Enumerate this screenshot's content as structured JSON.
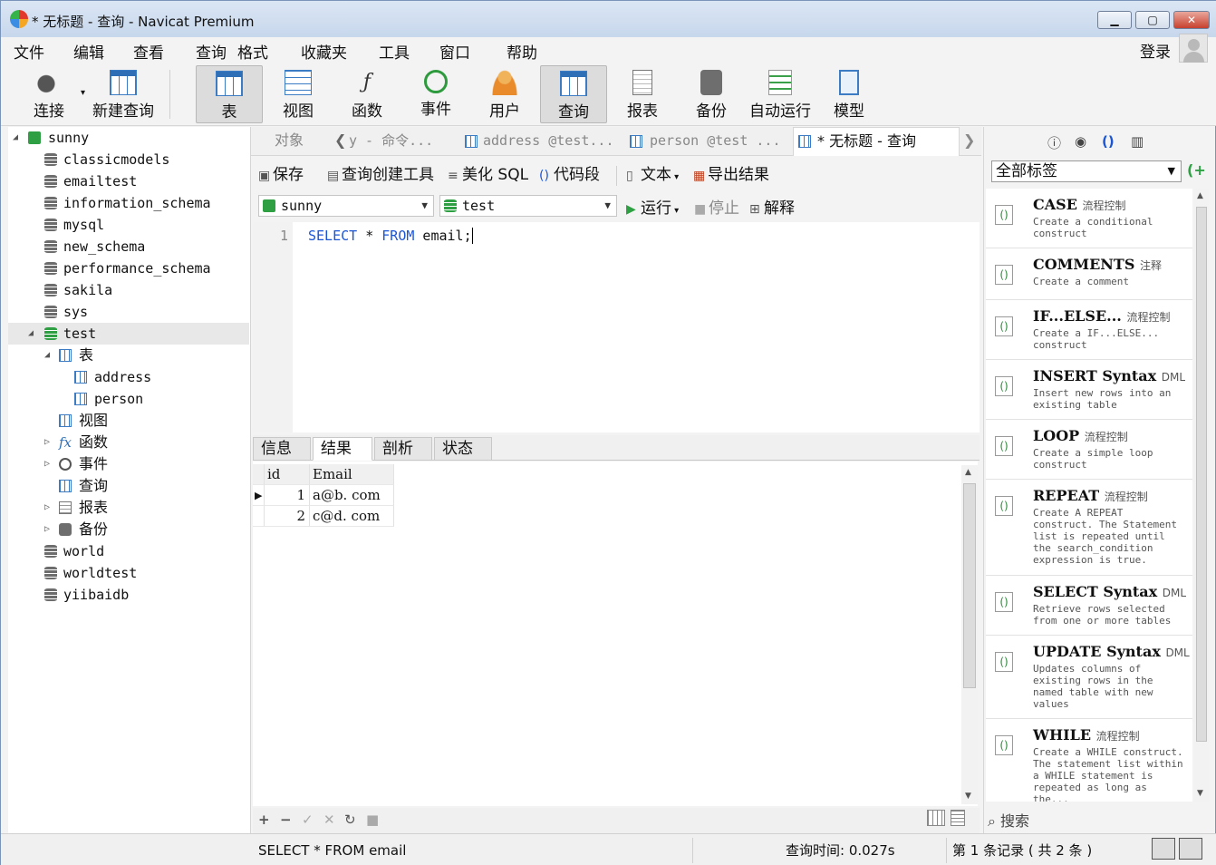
{
  "window": {
    "title": "* 无标题 - 查询 - Navicat Premium",
    "minimize_label": "▁",
    "maximize_label": "▢",
    "close_label": "✕"
  },
  "menu": [
    "文件",
    "编辑",
    "查看",
    "查询",
    "格式",
    "收藏夹",
    "工具",
    "窗口",
    "帮助"
  ],
  "account": {
    "login_label": "登录"
  },
  "toolbar": [
    {
      "label": "连接",
      "icon": "plug-icon"
    },
    {
      "label": "新建查询",
      "icon": "new-query-icon"
    },
    {
      "label": "表",
      "icon": "table-icon"
    },
    {
      "label": "视图",
      "icon": "view-icon"
    },
    {
      "label": "函数",
      "icon": "function-icon"
    },
    {
      "label": "事件",
      "icon": "clock-icon"
    },
    {
      "label": "用户",
      "icon": "user-icon"
    },
    {
      "label": "查询",
      "icon": "query-icon"
    },
    {
      "label": "报表",
      "icon": "report-icon"
    },
    {
      "label": "备份",
      "icon": "backup-icon"
    },
    {
      "label": "自动运行",
      "icon": "autorun-icon"
    },
    {
      "label": "模型",
      "icon": "model-icon"
    }
  ],
  "tree": {
    "connection": "sunny",
    "databases": [
      "classicmodels",
      "emailtest",
      "information_schema",
      "mysql",
      "new_schema",
      "performance_schema",
      "sakila",
      "sys"
    ],
    "open_database": "test",
    "groups": {
      "tables_label": "表",
      "tables": [
        "address",
        "person"
      ],
      "views_label": "视图",
      "functions_label": "函数",
      "events_label": "事件",
      "queries_label": "查询",
      "reports_label": "报表",
      "backups_label": "备份"
    },
    "databases_after": [
      "world",
      "worldtest",
      "yiibaidb"
    ]
  },
  "tabs": {
    "objects": "对象",
    "t1": "y - 命令...",
    "t2": "address @test...",
    "t3": "person @test ...",
    "t4": "* 无标题 - 查询"
  },
  "editor_toolbar": {
    "save": "保存",
    "builder": "查询创建工具",
    "beautify": "美化 SQL",
    "snippet": "代码段",
    "text": "文本",
    "export": "导出结果",
    "run": "运行",
    "stop": "停止",
    "explain": "解释",
    "connection_value": "sunny",
    "database_value": "test"
  },
  "editor": {
    "line_number": "1",
    "kw_select": "SELECT",
    "star": " * ",
    "kw_from": "FROM",
    "rest": " email;"
  },
  "result_tabs": [
    "信息",
    "结果 1",
    "剖析",
    "状态"
  ],
  "result_grid": {
    "columns": [
      "id",
      "Email"
    ],
    "rows": [
      [
        "1",
        "a@b. com"
      ],
      [
        "2",
        "c@d. com"
      ]
    ]
  },
  "status": {
    "sql": "SELECT *  FROM email",
    "time": "查询时间: 0.027s",
    "records": "第 1 条记录 ( 共 2 条 )"
  },
  "snippet_panel": {
    "filter": "全部标签",
    "search_label": "搜索",
    "items": [
      {
        "name": "CASE",
        "tag": "流程控制",
        "desc": "Create a conditional construct"
      },
      {
        "name": "COMMENTS",
        "tag": "注释",
        "desc": "Create a comment"
      },
      {
        "name": "IF...ELSE...",
        "tag": "流程控制",
        "desc": "Create a IF...ELSE... construct"
      },
      {
        "name": "INSERT Syntax",
        "tag": "DML",
        "desc": "Insert new rows into an existing table"
      },
      {
        "name": "LOOP",
        "tag": "流程控制",
        "desc": "Create a simple loop construct"
      },
      {
        "name": "REPEAT",
        "tag": "流程控制",
        "desc": "Create A REPEAT construct. The Statement list is repeated until the search_condition expression is true."
      },
      {
        "name": "SELECT Syntax",
        "tag": "DML",
        "desc": "Retrieve rows selected from one or more tables"
      },
      {
        "name": "UPDATE Syntax",
        "tag": "DML",
        "desc": "Updates columns of existing rows in the named table with new values"
      },
      {
        "name": "WHILE",
        "tag": "流程控制",
        "desc": "Create a WHILE construct. The statement list within a WHILE statement is repeated as long as the..."
      }
    ]
  }
}
